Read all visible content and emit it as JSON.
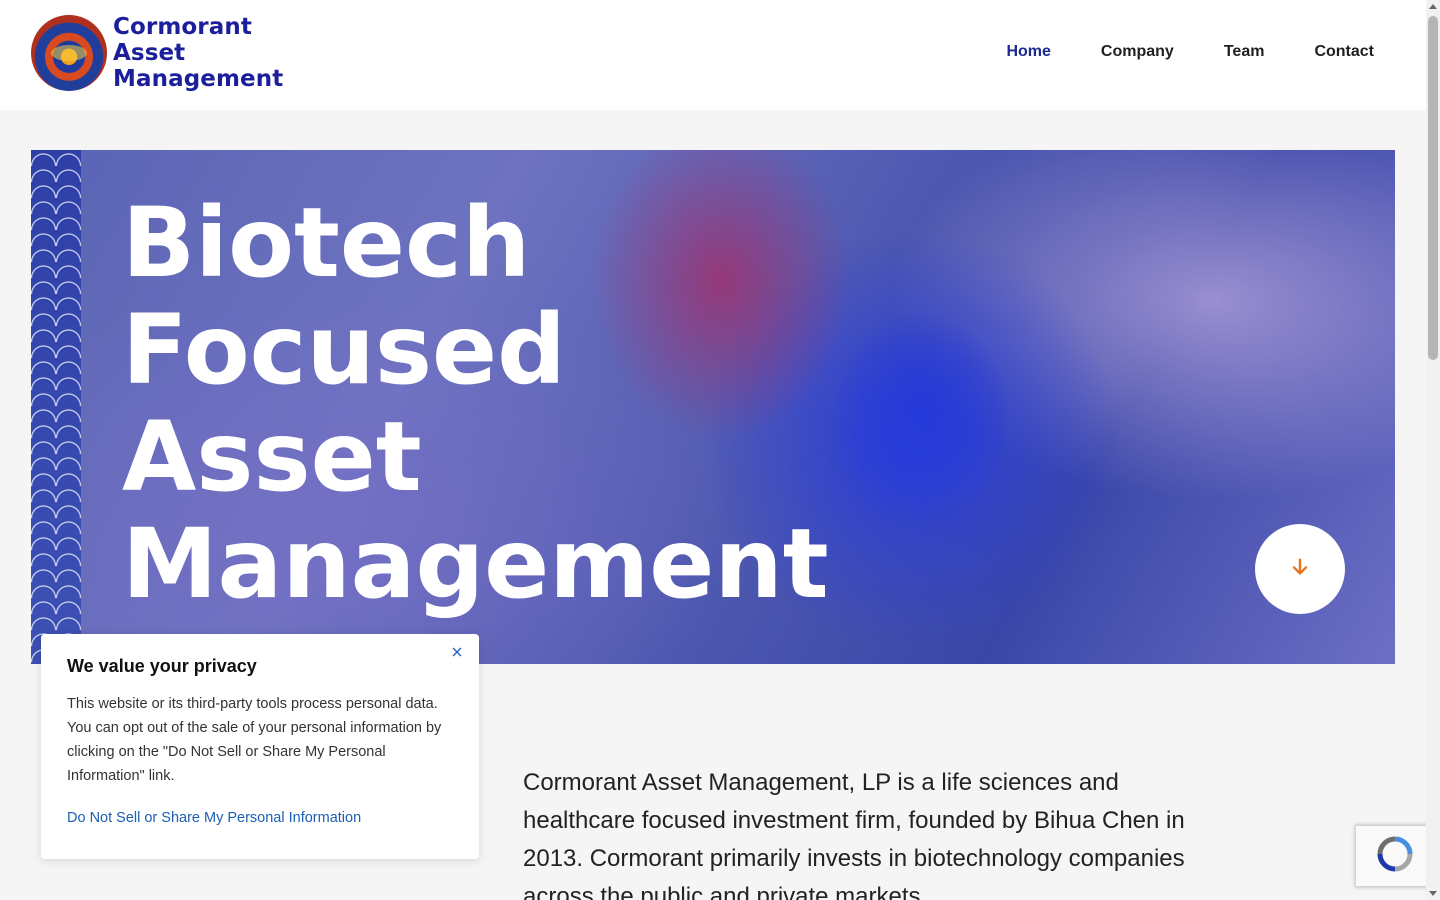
{
  "brand": {
    "line1": "Cormorant",
    "line2": "Asset",
    "line3": "Management",
    "color": "#1b1f9b"
  },
  "nav": {
    "items": [
      {
        "label": "Home",
        "active": true
      },
      {
        "label": "Company",
        "active": false
      },
      {
        "label": "Team",
        "active": false
      },
      {
        "label": "Contact",
        "active": false
      }
    ]
  },
  "hero": {
    "title_line1": "Biotech",
    "title_line2": "Focused",
    "title_line3": "Asset",
    "title_line4": "Management",
    "scroll_icon": "arrow-down-icon",
    "accent": "#e8721c"
  },
  "intro": {
    "text": "Cormorant Asset Management, LP is a life sciences and healthcare focused investment firm, founded by Bihua Chen in 2013. Cormorant primarily invests in biotechnology companies across the public and private markets."
  },
  "privacy": {
    "title": "We value your privacy",
    "body": "This website or its third-party tools process personal data. You can opt out of the sale of your personal information by clicking on the \"Do Not Sell or Share My Personal Information\" link.",
    "link": "Do Not Sell or Share My Personal Information",
    "close_icon": "close-icon",
    "link_color": "#1d5fb3"
  }
}
